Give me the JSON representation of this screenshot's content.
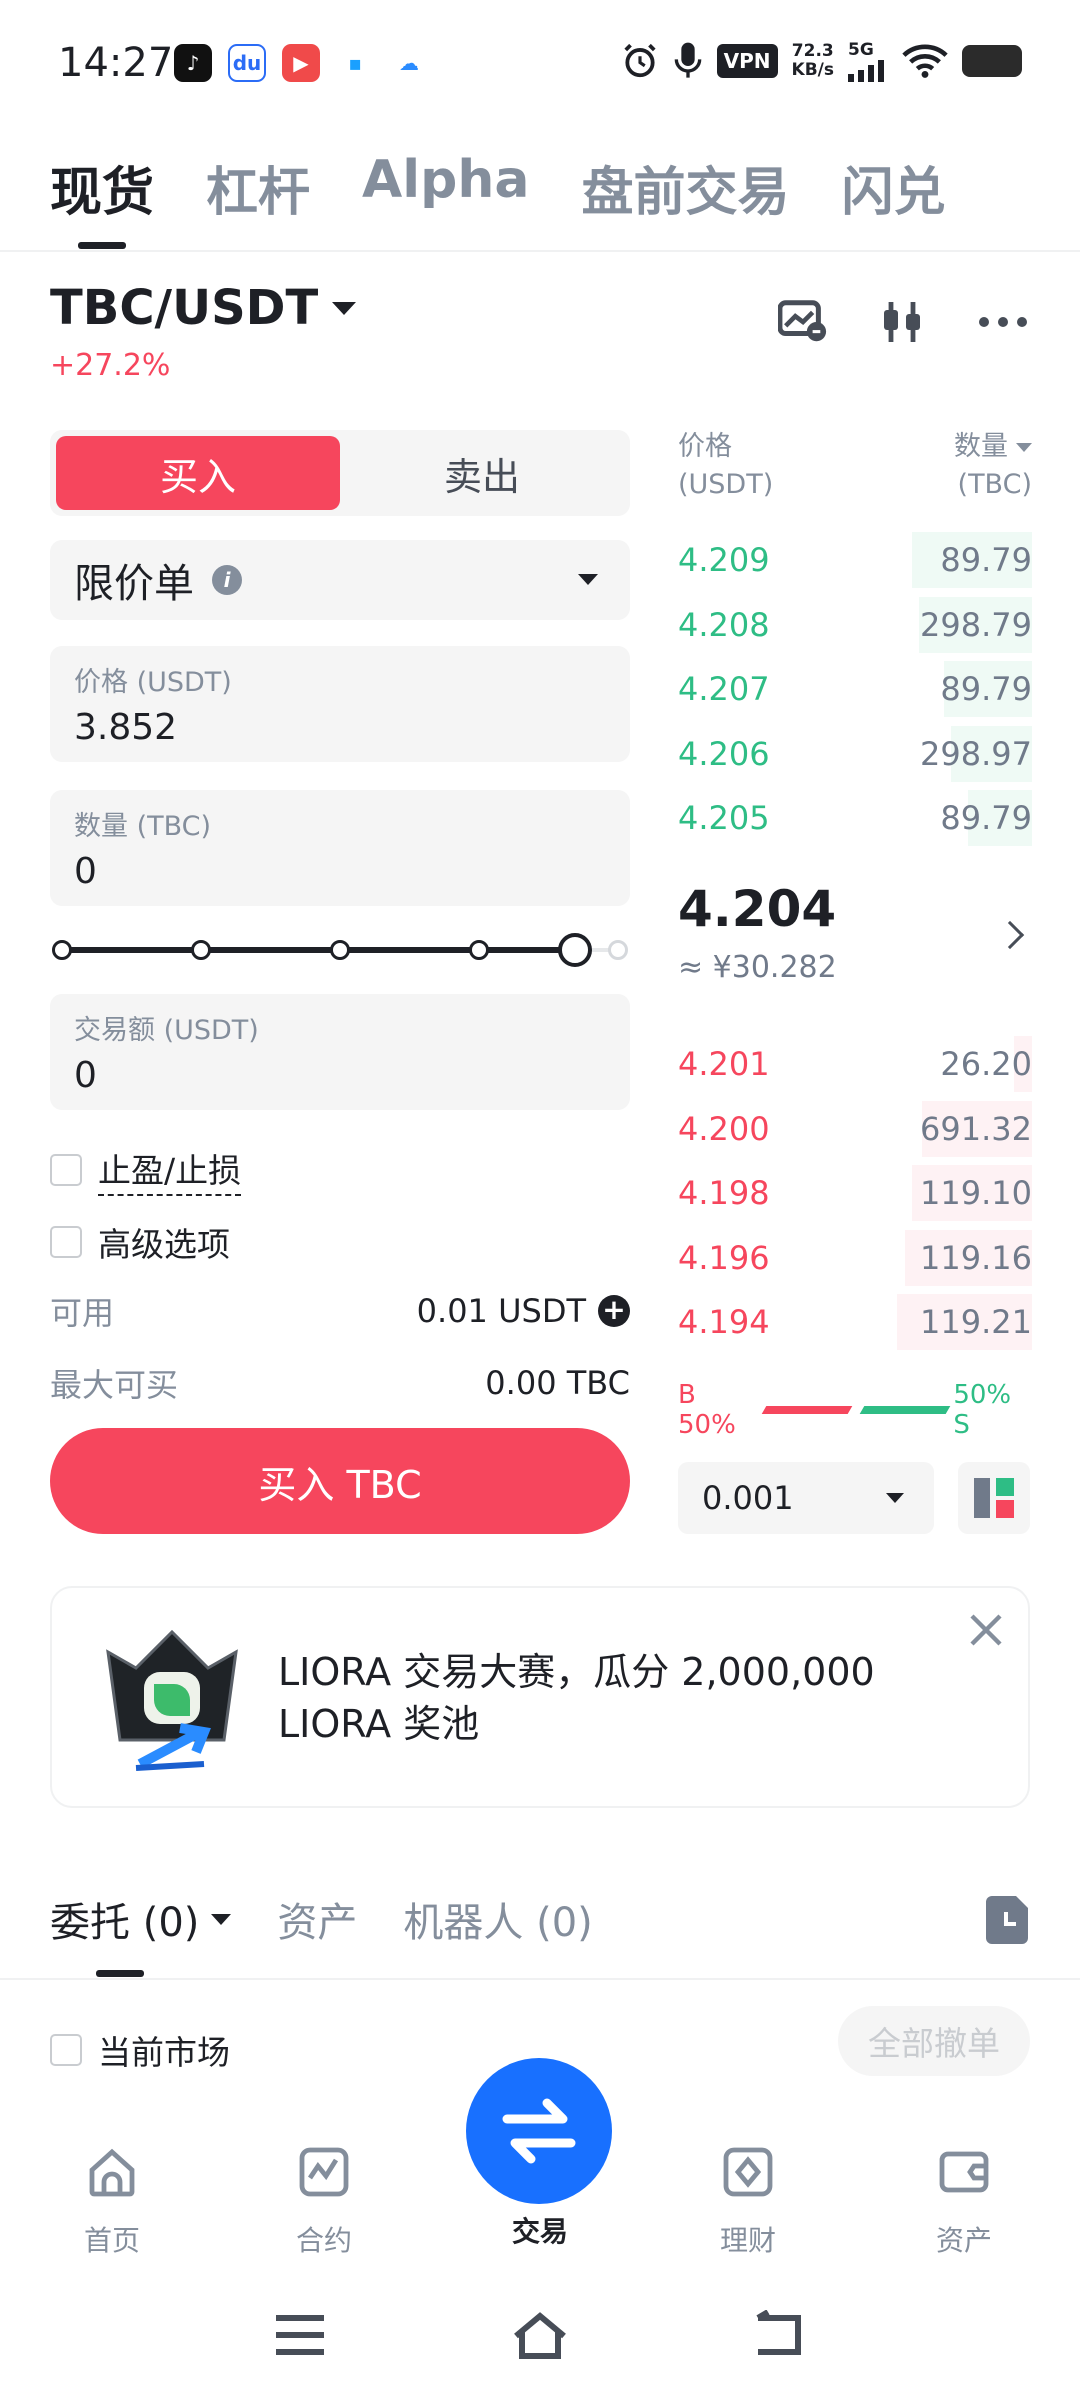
{
  "status_bar": {
    "time": "14:27",
    "vpn": "VPN",
    "net_speed_value": "72.3",
    "net_speed_unit": "KB/s",
    "network": "5G"
  },
  "top_tabs": [
    "现货",
    "杠杆",
    "Alpha",
    "盘前交易",
    "闪兑"
  ],
  "pair": {
    "symbol": "TBC/USDT",
    "change": "+27.2%"
  },
  "order_form": {
    "buy_label": "买入",
    "sell_label": "卖出",
    "order_type": "限价单",
    "price_label": "价格 (USDT)",
    "price_value": "3.852",
    "amount_label": "数量 (TBC)",
    "amount_value": "0",
    "slider_percent": 95,
    "total_label": "交易额 (USDT)",
    "total_value": "0",
    "tp_sl_label": "止盈/止损",
    "advanced_label": "高级选项",
    "available_label": "可用",
    "available_value": "0.01 USDT",
    "max_buy_label": "最大可买",
    "max_buy_value": "0.00 TBC",
    "submit_label": "买入 TBC"
  },
  "order_book": {
    "price_header_1": "价格",
    "price_header_2": "(USDT)",
    "qty_header_1": "数量",
    "qty_header_2": "(TBC)",
    "asks": [
      {
        "price": "4.209",
        "qty": "89.79",
        "depth": 0.34
      },
      {
        "price": "4.208",
        "qty": "298.79",
        "depth": 0.32
      },
      {
        "price": "4.207",
        "qty": "89.79",
        "depth": 0.25
      },
      {
        "price": "4.206",
        "qty": "298.97",
        "depth": 0.23
      },
      {
        "price": "4.205",
        "qty": "89.79",
        "depth": 0.18
      }
    ],
    "last_price": "4.204",
    "last_price_cny": "≈ ¥30.282",
    "bids": [
      {
        "price": "4.201",
        "qty": "26.20",
        "depth": 0.05
      },
      {
        "price": "4.200",
        "qty": "691.32",
        "depth": 0.31
      },
      {
        "price": "4.198",
        "qty": "119.10",
        "depth": 0.34
      },
      {
        "price": "4.196",
        "qty": "119.16",
        "depth": 0.36
      },
      {
        "price": "4.194",
        "qty": "119.21",
        "depth": 0.38
      }
    ],
    "buy_ratio_label": "B 50%",
    "sell_ratio_label": "50% S",
    "buy_ratio": 0.5,
    "tick_size": "0.001"
  },
  "banner": {
    "line1": "LIORA 交易大赛，瓜分 2,000,000",
    "line2": "LIORA 奖池"
  },
  "bottom_tabs": {
    "orders": "委托 (0)",
    "assets": "资产",
    "bots": "机器人 (0)"
  },
  "orders_filter": {
    "current_market": "当前市场",
    "cancel_all": "全部撤单"
  },
  "bottom_nav": {
    "home": "首页",
    "futures": "合约",
    "trade": "交易",
    "earn": "理财",
    "assets": "资产"
  },
  "colors": {
    "buy_red": "#f6465d",
    "sell_green": "#2ebd85",
    "brand_blue": "#1870ff"
  }
}
